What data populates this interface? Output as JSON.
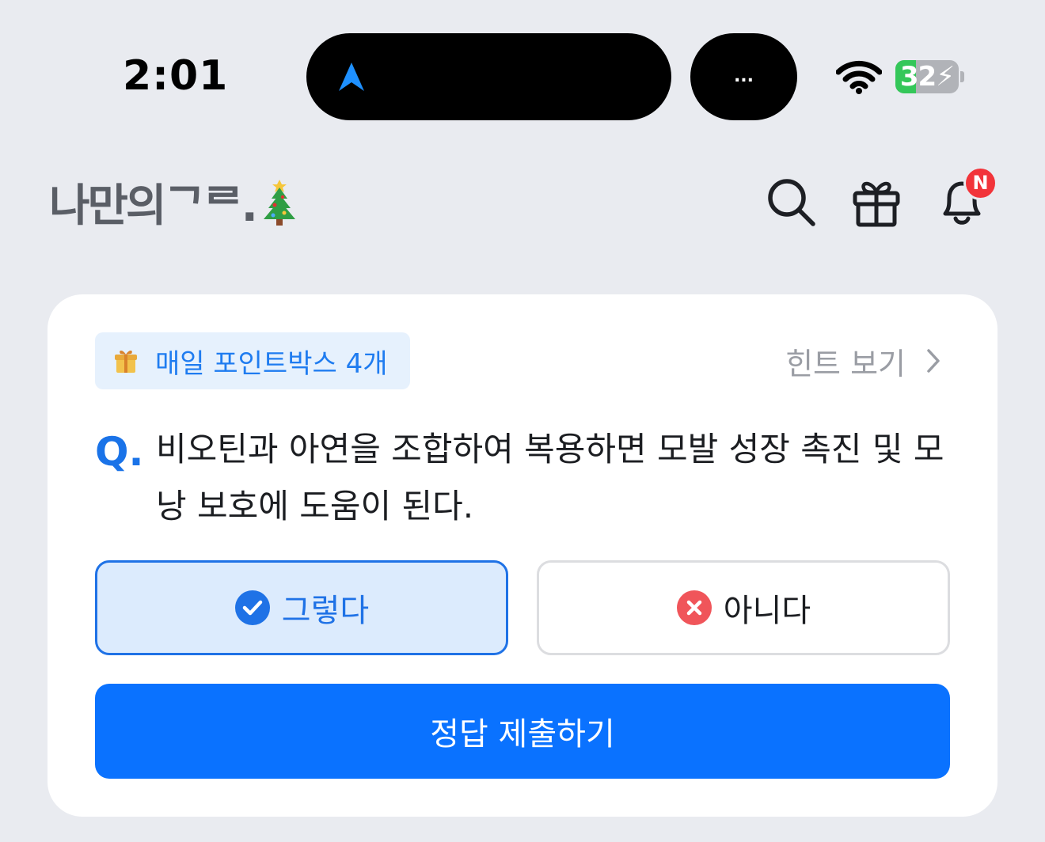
{
  "status_bar": {
    "time": "2:01",
    "activity_dots": "...",
    "battery_level": "32",
    "battery_percent": 32
  },
  "header": {
    "logo_text": "나만의ᄀᄅ.",
    "notification_badge": "N"
  },
  "card": {
    "point_chip_label": "매일 포인트박스 4개",
    "hint_label": "힌트 보기",
    "question_prefix": "Q.",
    "question_text": "비오틴과 아연을 조합하여 복용하면 모발 성장 촉진 및 모낭 보호에 도움이 된다.",
    "answers": [
      {
        "label": "그렇다",
        "selected": true
      },
      {
        "label": "아니다",
        "selected": false
      }
    ],
    "submit_label": "정답 제출하기"
  },
  "colors": {
    "accent": "#0a72ff",
    "selected_bg": "#dcebfd",
    "wrong_red": "#f0555a",
    "badge_red": "#f2343a",
    "battery_green": "#34c759"
  }
}
